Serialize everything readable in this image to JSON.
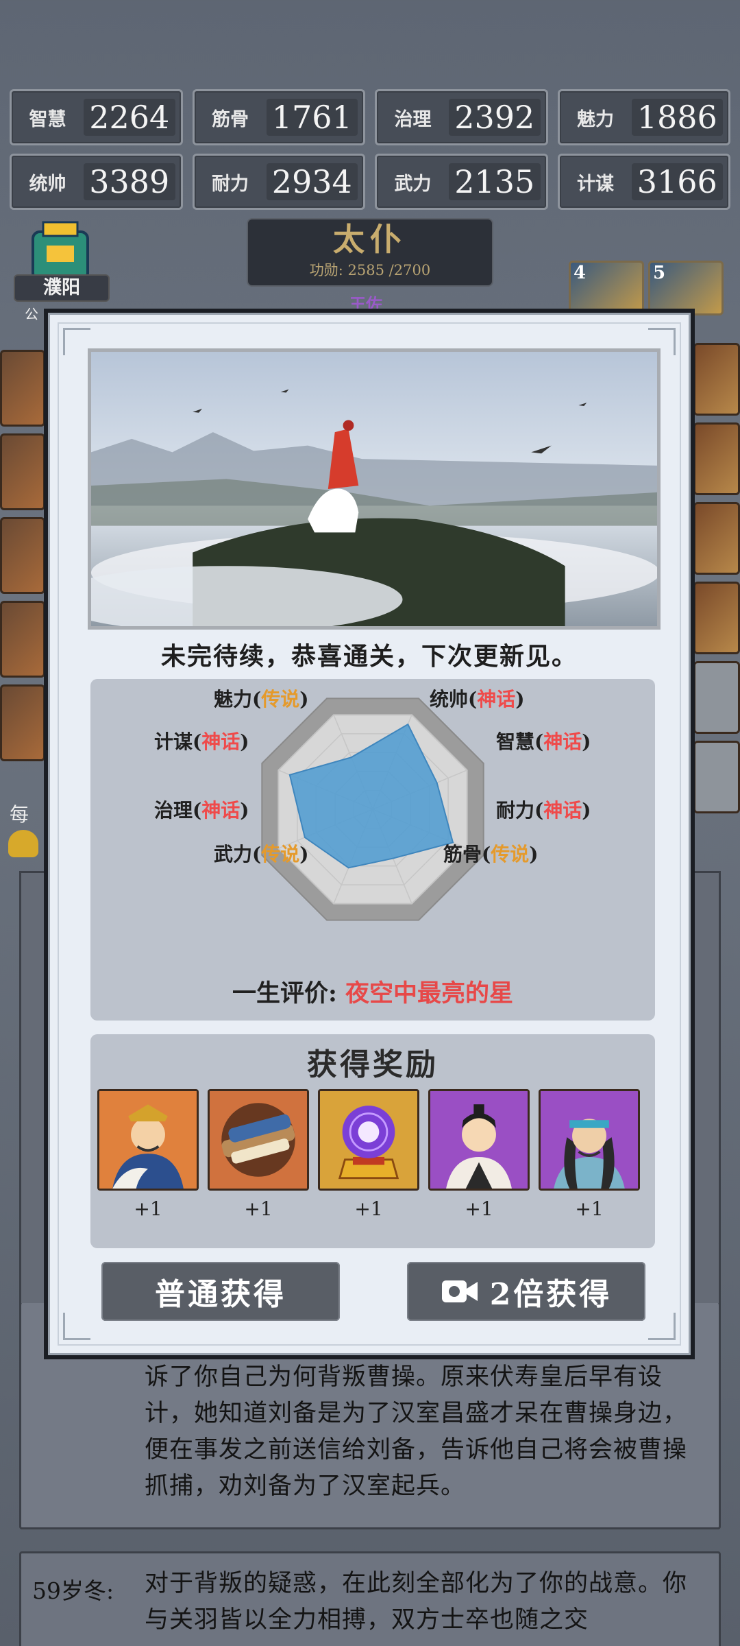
{
  "stats": [
    {
      "name": "智慧",
      "value": "2264"
    },
    {
      "name": "筋骨",
      "value": "1761"
    },
    {
      "name": "治理",
      "value": "2392"
    },
    {
      "name": "魅力",
      "value": "1886"
    },
    {
      "name": "统帅",
      "value": "3389"
    },
    {
      "name": "耐力",
      "value": "2934"
    },
    {
      "name": "武力",
      "value": "2135"
    },
    {
      "name": "计谋",
      "value": "3166"
    }
  ],
  "rank": {
    "title": "太仆",
    "merit": "功勋: 2585 /2700",
    "subtitle": "王佐"
  },
  "city": {
    "name": "濮阳",
    "tail": "公"
  },
  "top_cards": [
    "4",
    "5"
  ],
  "left_side": {
    "each_label": "每"
  },
  "modal": {
    "caption": "未完待续，恭喜通关，下次更新见。",
    "radar": {
      "axes": [
        {
          "name": "统帅",
          "grade": "神话",
          "level": 0.9
        },
        {
          "name": "智慧",
          "grade": "神话",
          "level": 0.68
        },
        {
          "name": "耐力",
          "grade": "神话",
          "level": 0.85
        },
        {
          "name": "筋骨",
          "grade": "传说",
          "level": 0.52
        },
        {
          "name": "武力",
          "grade": "传说",
          "level": 0.62
        },
        {
          "name": "治理",
          "grade": "神话",
          "level": 0.72
        },
        {
          "name": "计谋",
          "grade": "神话",
          "level": 0.88
        },
        {
          "name": "魅力",
          "grade": "传说",
          "level": 0.55
        }
      ],
      "colors": {
        "神话": "#ef4a4a",
        "传说": "#e59a2b",
        "fill": "#4d9bd1"
      }
    },
    "lifetime_label": "一生评价:",
    "lifetime_value": "夜空中最亮的星",
    "reward_title": "获得奖励",
    "rewards": [
      {
        "icon": "general-portrait-icon",
        "count": "+1"
      },
      {
        "icon": "scroll-icon",
        "count": "+1"
      },
      {
        "icon": "crystal-orb-icon",
        "count": "+1"
      },
      {
        "icon": "scholar-portrait-icon",
        "count": "+1"
      },
      {
        "icon": "warrior-portrait-icon",
        "count": "+1"
      }
    ],
    "btn_normal": "普通获得",
    "btn_double": "2倍获得"
  },
  "log": {
    "upper_text": "诉了你自己为何背叛曹操。原来伏寿皇后早有设计，她知道刘备是为了汉室昌盛才呆在曹操身边，便在事发之前送信给刘备，告诉他自己将会被曹操抓捕，劝刘备为了汉室起兵。",
    "lower_age": "59岁冬:",
    "lower_text": "对于背叛的疑惑，在此刻全部化为了你的战意。你与关羽皆以全力相搏，双方士卒也随之交"
  }
}
